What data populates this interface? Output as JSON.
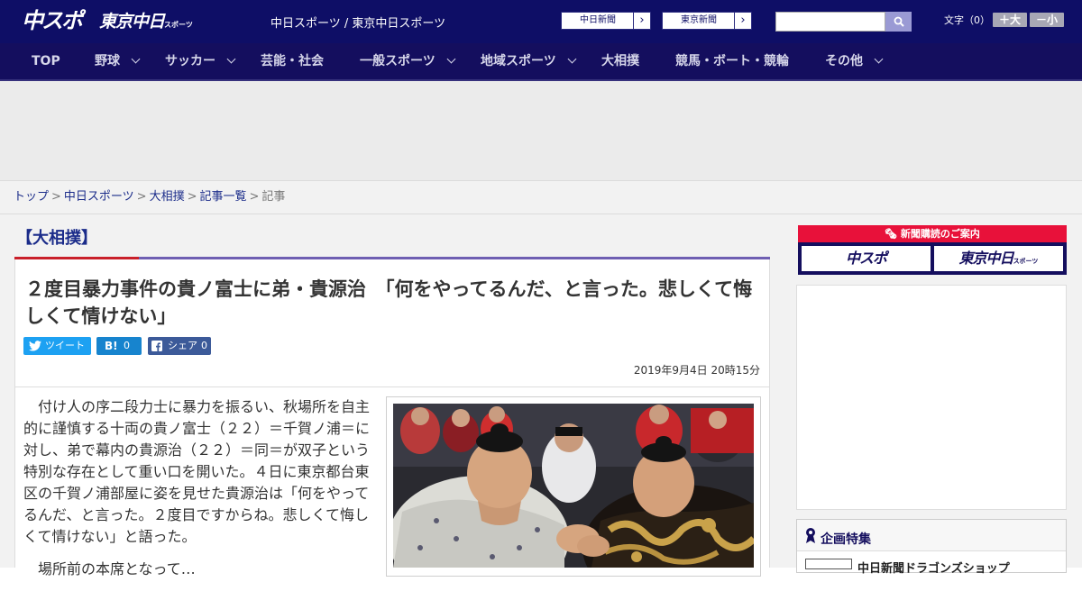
{
  "header": {
    "logo_main": "中スポ",
    "logo_sub": "東京中日",
    "logo_sub_small": "スポーツ",
    "site_title": "中日スポーツ / 東京中日スポーツ",
    "paper_links": [
      "中日新聞",
      "東京新聞"
    ],
    "text_size_label": "文字（0）",
    "text_larger": "＋大",
    "text_smaller": "－小"
  },
  "nav": {
    "items": [
      {
        "label": "TOP",
        "dropdown": false
      },
      {
        "label": "野球",
        "dropdown": true
      },
      {
        "label": "サッカー",
        "dropdown": true
      },
      {
        "label": "芸能・社会",
        "dropdown": false
      },
      {
        "label": "一般スポーツ",
        "dropdown": true
      },
      {
        "label": "地域スポーツ",
        "dropdown": true
      },
      {
        "label": "大相撲",
        "dropdown": false
      },
      {
        "label": "競馬・ボート・競輪",
        "dropdown": false
      },
      {
        "label": "その他",
        "dropdown": true
      }
    ]
  },
  "breadcrumb": {
    "items": [
      "トップ",
      "中日スポーツ",
      "大相撲",
      "記事一覧"
    ],
    "current": "記事",
    "separator": ">"
  },
  "article": {
    "category": "【大相撲】",
    "headline": "２度目暴力事件の貴ノ富士に弟・貴源治　「何をやってるんだ、と言った。悲しくて悔しくて情けない」",
    "share": {
      "tweet_label": "ツイート",
      "hatena_count": "0",
      "facebook_label": "シェア",
      "facebook_count": "0"
    },
    "published": "2019年9月4日 20時15分",
    "paragraphs": [
      "　付け人の序二段力士に暴力を振るい、秋場所を自主的に謹慎する十両の貴ノ富士（２２）＝千賀ノ浦＝に対し、弟で幕内の貴源治（２２）＝同＝が双子という特別な存在として重い口を開いた。４日に東京都台東区の千賀ノ浦部屋に姿を見せた貴源治は「何をやってるんだ、と言った。２度目ですからね。悲しくて悔しくて情けない」と語った。",
      "　場所前の本席となって…"
    ]
  },
  "sidebar": {
    "subscribe_title": "新聞購読のご案内",
    "subscribe_logos": [
      "中スポ",
      "東京中日"
    ],
    "subscribe_logo_small": "スポーツ",
    "feature_title": "企画特集",
    "feature_item": "中日新聞ドラゴンズショップ"
  },
  "colors": {
    "header_bg": "#0e0e66",
    "nav_bg": "#140e5e",
    "accent_red": "#c9202a",
    "accent_purple": "#6f5fb2",
    "link_blue": "#1b2c8a",
    "twitter": "#1da1f2",
    "hatena": "#1784ce",
    "facebook": "#3c5a99",
    "subscribe_red": "#e8113a"
  }
}
